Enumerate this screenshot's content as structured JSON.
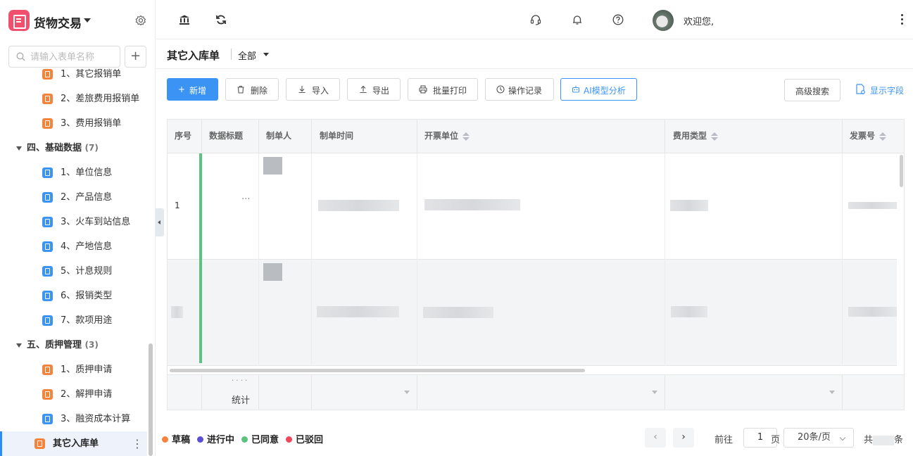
{
  "app": {
    "title": "货物交易"
  },
  "sidebar": {
    "search_placeholder": "请输入表单名称",
    "items": [
      {
        "label": "1、其它报销单",
        "color": "#f4843c"
      },
      {
        "label": "2、差旅费用报销单",
        "color": "#f4843c"
      },
      {
        "label": "3、费用报销单",
        "color": "#f4843c"
      },
      {
        "label": "四、基础数据",
        "count": "(7)"
      },
      {
        "label": "1、单位信息",
        "color": "#3b94f4"
      },
      {
        "label": "2、产品信息",
        "color": "#3b94f4"
      },
      {
        "label": "3、火车到站信息",
        "color": "#3b94f4"
      },
      {
        "label": "4、产地信息",
        "color": "#3b94f4"
      },
      {
        "label": "5、计息规则",
        "color": "#3b94f4"
      },
      {
        "label": "6、报销类型",
        "color": "#3b94f4"
      },
      {
        "label": "7、款项用途",
        "color": "#3b94f4"
      },
      {
        "label": "五、质押管理",
        "count": "(3)"
      },
      {
        "label": "1、质押申请",
        "color": "#f4843c"
      },
      {
        "label": "2、解押申请",
        "color": "#f4843c"
      },
      {
        "label": "3、融资成本计算",
        "color": "#3b94f4"
      },
      {
        "label": "其它入库单",
        "color": "#f4843c"
      }
    ]
  },
  "topbar": {
    "welcome": "欢迎您,"
  },
  "page": {
    "title": "其它入库单",
    "filter": "全部"
  },
  "toolbar": {
    "new": "新增",
    "delete": "删除",
    "import": "导入",
    "export": "导出",
    "batch_print": "批量打印",
    "op_log": "操作记录",
    "ai_analysis": "AI模型分析",
    "advanced_search": "高级搜索",
    "show_fields": "显示字段"
  },
  "table": {
    "columns": [
      "序号",
      "数据标题",
      "制单人",
      "制单时间",
      "开票单位",
      "费用类型",
      "发票号"
    ],
    "rows": [
      {
        "index": "1",
        "title": "···"
      },
      {
        "index": "",
        "title": ""
      }
    ],
    "summary_label": "统计",
    "summary_dots": "· · · ·"
  },
  "legend": [
    {
      "label": "草稿",
      "color": "#f4843c"
    },
    {
      "label": "进行中",
      "color": "#5b4fd6"
    },
    {
      "label": "已同意",
      "color": "#5ac47e"
    },
    {
      "label": "已驳回",
      "color": "#f0475a"
    }
  ],
  "pagination": {
    "prev": "‹",
    "next": "›",
    "goto": "前往",
    "page": "1",
    "page_unit": "页",
    "page_size": "20条/页",
    "total_prefix": "共",
    "total_suffix": "条"
  }
}
